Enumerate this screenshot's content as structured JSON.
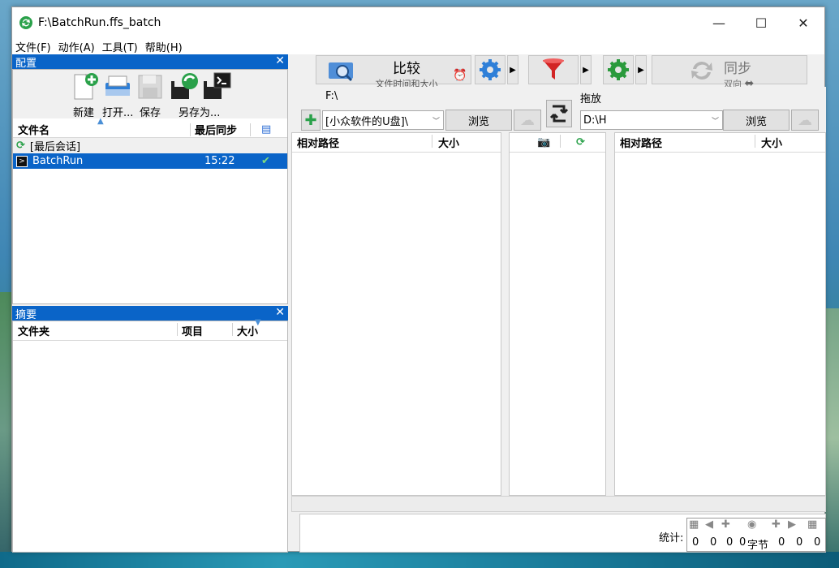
{
  "window": {
    "title": "F:\\BatchRun.ffs_batch"
  },
  "menu": [
    "文件(F)",
    "动作(A)",
    "工具(T)",
    "帮助(H)"
  ],
  "config_panel": {
    "title": "配置",
    "buttons": [
      {
        "label": "新建",
        "icon": "new-file-icon"
      },
      {
        "label": "打开...",
        "icon": "open-icon"
      },
      {
        "label": "保存",
        "icon": "save-icon"
      },
      {
        "label": "另存为...",
        "icon": "save-as-icon"
      }
    ],
    "columns": {
      "name": "文件名",
      "last_sync": "最后同步"
    },
    "rows": [
      {
        "name": "[最后会话]",
        "time": "",
        "selected": false
      },
      {
        "name": "BatchRun",
        "time": "15:22",
        "selected": true
      }
    ]
  },
  "summary_panel": {
    "title": "摘要",
    "columns": {
      "folder": "文件夹",
      "items": "项目",
      "size": "大小"
    }
  },
  "toolbar": {
    "compare": {
      "label": "比较",
      "sub": "文件时间和大小"
    },
    "sync": {
      "label": "同步",
      "sub": "双向"
    }
  },
  "left_side": {
    "folder_label": "F:\\",
    "dropdown_value": "[小众软件的U盘]\\",
    "browse": "浏览"
  },
  "right_side": {
    "folder_label": "拖放",
    "dropdown_value": "D:\\H",
    "browse": "浏览"
  },
  "grid": {
    "left_cols": {
      "path": "相对路径",
      "size": "大小"
    },
    "right_cols": {
      "path": "相对路径",
      "size": "大小"
    }
  },
  "stats": {
    "label": "统计:",
    "values": [
      "0",
      "0",
      "0",
      "0",
      "字节",
      "0",
      "0",
      "0"
    ]
  },
  "colors": {
    "accent": "#0a64c8",
    "background": "#f0f0f0"
  }
}
